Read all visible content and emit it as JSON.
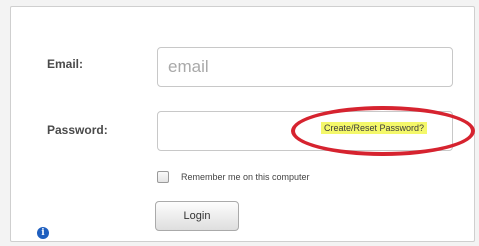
{
  "login_form": {
    "email_label": "Email:",
    "email_placeholder": "email",
    "password_label": "Password:",
    "password_value": "",
    "reset_link_label": "Create/Reset Password?",
    "remember_label": "Remember me on this computer",
    "remember_checked": false,
    "login_button_label": "Login",
    "info_icon": "info-icon",
    "info_icon_glyph": "i"
  },
  "colors": {
    "highlight_ellipse": "#d6232f",
    "link_highlight": "#f4f86a",
    "info_icon": "#1f5fbf"
  }
}
